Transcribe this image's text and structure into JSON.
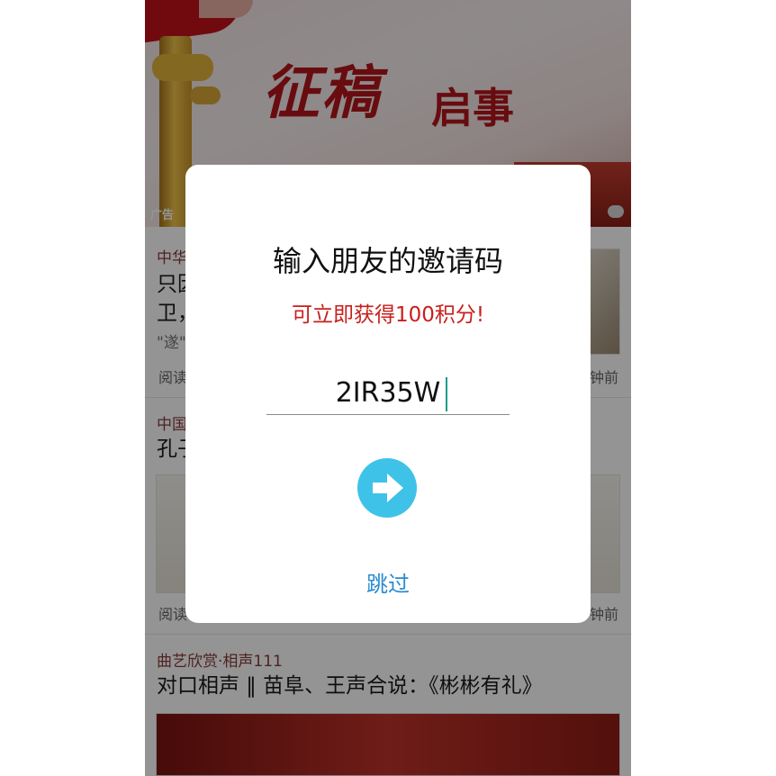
{
  "banner": {
    "title_main": "征稿",
    "title_sub": "启事",
    "ad_tag": "广告"
  },
  "feed": [
    {
      "category": "中华",
      "headline_line1": "只因",
      "headline_line2": "卫，",
      "snippet": "\"遂\"",
      "meta_left": "阅读",
      "meta_right": "钟前"
    },
    {
      "category": "中国",
      "headline": "孔子",
      "meta_left": "阅读",
      "meta_right": "钟前"
    },
    {
      "category": "曲艺欣赏·相声111",
      "headline": "对口相声 ‖ 苗阜、王声合说：《彬彬有礼》"
    }
  ],
  "dialog": {
    "title": "输入朋友的邀请码",
    "subtitle": "可立即获得100积分!",
    "code_value": "2IR35W",
    "skip_label": "跳过",
    "go_icon": "arrow-right-icon",
    "accent_color": "#3fc2e8",
    "subtitle_color": "#c8201c",
    "skip_color": "#2a8bd0"
  }
}
